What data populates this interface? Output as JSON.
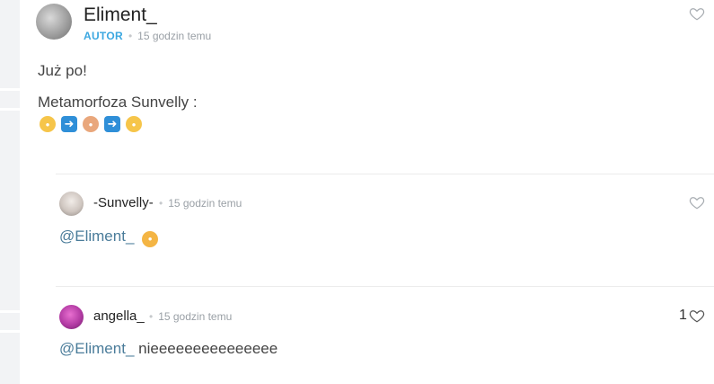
{
  "comments": [
    {
      "author": "Eliment_",
      "badge": "AUTOR",
      "time": "15 godzin temu",
      "lines": [
        "Już po!",
        "Metamorfoza Sunvelly :"
      ],
      "emojis": [
        "woman-face-emoji",
        "arrow-right-emoji",
        "person-gesturing-emoji",
        "arrow-right-emoji",
        "baby-face-emoji"
      ]
    },
    {
      "author": "-Sunvelly-",
      "time": "15 godzin temu",
      "mention": "@Eliment_",
      "emoji": "crying-face-emoji"
    },
    {
      "author": "angella_",
      "time": "15 godzin temu",
      "mention": "@Eliment_",
      "text": "nieeeeeeeeeeeeeee",
      "likes": "1"
    }
  ],
  "colors": {
    "badge": "#3ba7e0",
    "mention": "#4a7c9a",
    "meta": "#9aa0a6",
    "emoji_arrow": "#2f8fd8"
  }
}
